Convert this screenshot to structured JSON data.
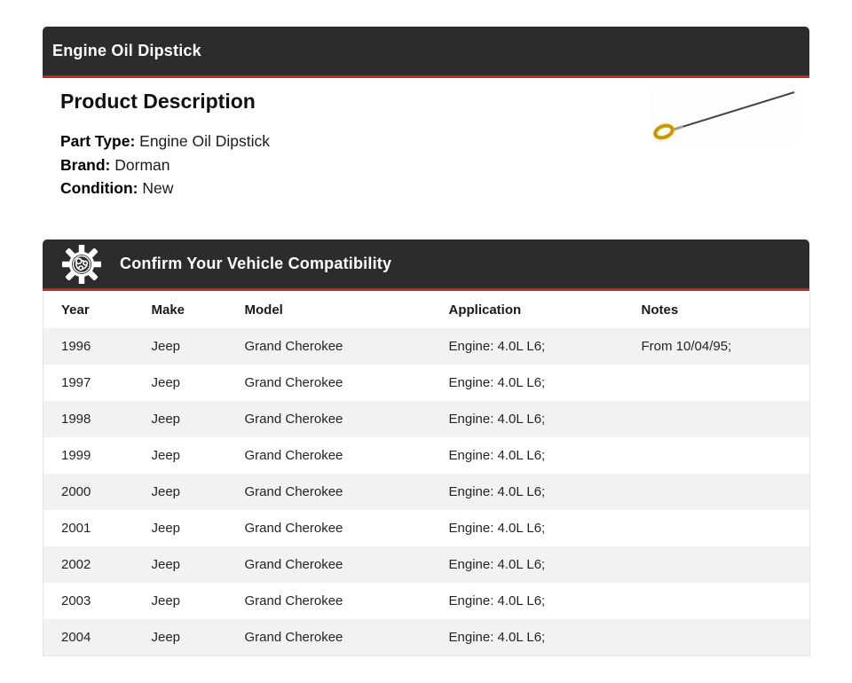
{
  "title_bar": {
    "title": "Engine Oil Dipstick"
  },
  "description": {
    "heading": "Product Description",
    "details": [
      {
        "label": "Part Type:",
        "value": "Engine Oil Dipstick"
      },
      {
        "label": "Brand:",
        "value": "Dorman"
      },
      {
        "label": "Condition:",
        "value": "New"
      }
    ],
    "product_image": "engine-oil-dipstick-photo"
  },
  "compatibility": {
    "icon": "engine-gear-icon",
    "heading": "Confirm Your Vehicle Compatibility",
    "table": {
      "columns": [
        "Year",
        "Make",
        "Model",
        "Application",
        "Notes"
      ],
      "rows": [
        [
          "1996",
          "Jeep",
          "Grand Cherokee",
          "Engine: 4.0L L6;",
          "From 10/04/95;"
        ],
        [
          "1997",
          "Jeep",
          "Grand Cherokee",
          "Engine: 4.0L L6;",
          ""
        ],
        [
          "1998",
          "Jeep",
          "Grand Cherokee",
          "Engine: 4.0L L6;",
          ""
        ],
        [
          "1999",
          "Jeep",
          "Grand Cherokee",
          "Engine: 4.0L L6;",
          ""
        ],
        [
          "2000",
          "Jeep",
          "Grand Cherokee",
          "Engine: 4.0L L6;",
          ""
        ],
        [
          "2001",
          "Jeep",
          "Grand Cherokee",
          "Engine: 4.0L L6;",
          ""
        ],
        [
          "2002",
          "Jeep",
          "Grand Cherokee",
          "Engine: 4.0L L6;",
          ""
        ],
        [
          "2003",
          "Jeep",
          "Grand Cherokee",
          "Engine: 4.0L L6;",
          ""
        ],
        [
          "2004",
          "Jeep",
          "Grand Cherokee",
          "Engine: 4.0L L6;",
          ""
        ]
      ]
    }
  },
  "colors": {
    "header_bg": "#2d2c2c",
    "accent_red": "#c22731",
    "row_stripe": "#f2f2f2",
    "dipstick_handle": "#d8a800"
  }
}
